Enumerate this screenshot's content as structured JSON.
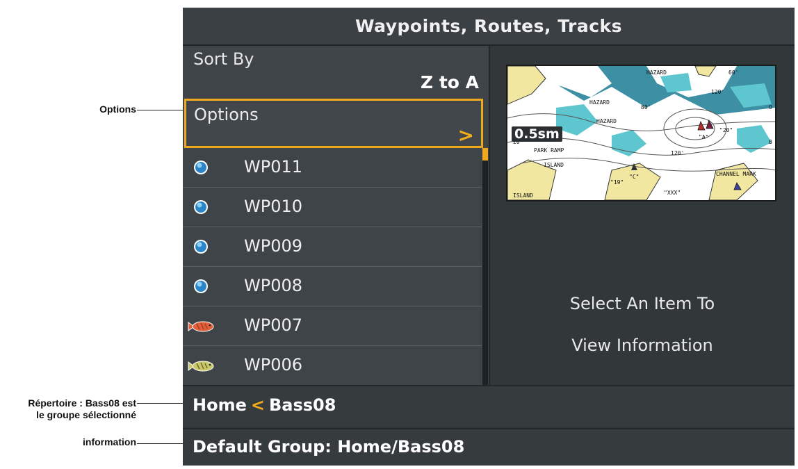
{
  "callouts": {
    "options": "Options",
    "directory_line1": "Répertoire : Bass08 est",
    "directory_line2": "le groupe sélectionné",
    "information": "information"
  },
  "screen": {
    "title": "Waypoints, Routes, Tracks",
    "sort_by": {
      "label": "Sort By",
      "value": "Z to A"
    },
    "options": {
      "label": "Options",
      "chevron": ">"
    },
    "waypoints": [
      {
        "name": "WP011",
        "icon": "blue-dot-icon"
      },
      {
        "name": "WP010",
        "icon": "blue-dot-icon"
      },
      {
        "name": "WP009",
        "icon": "blue-dot-icon"
      },
      {
        "name": "WP008",
        "icon": "blue-dot-icon"
      },
      {
        "name": "WP007",
        "icon": "red-fish-icon"
      },
      {
        "name": "WP006",
        "icon": "green-fish-icon"
      }
    ],
    "map_preview": {
      "scale": "0.5sm",
      "labels": [
        "HAZARD",
        "60'",
        "120'",
        "HAZARD",
        "80'",
        "HAZARD",
        "\"20\"",
        "\"A\"",
        "PARK RAMP",
        "120'",
        "ISLAND",
        "\"19\"",
        "\"C\"",
        "CHANNEL MARK",
        "ISLAND",
        "\"XXX\"",
        "20'",
        "O",
        "B"
      ]
    },
    "info_text": {
      "line1": "Select An Item To",
      "line2": "View Information"
    },
    "breadcrumb": {
      "home": "Home",
      "separator": "<",
      "current": "Bass08"
    },
    "info_bar": "Default Group: Home/Bass08"
  },
  "colors": {
    "accent": "#f0a81e",
    "background": "#32373a",
    "panel": "#3e4447",
    "water": "#3d8fa4",
    "land": "#f1e7a1"
  }
}
